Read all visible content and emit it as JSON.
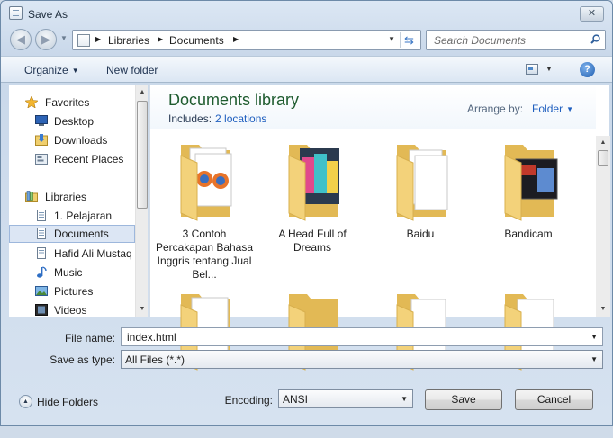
{
  "window": {
    "title": "Save As"
  },
  "address": {
    "segments": [
      "Libraries",
      "Documents"
    ]
  },
  "search": {
    "placeholder": "Search Documents"
  },
  "toolbar": {
    "organize": "Organize",
    "new_folder": "New folder"
  },
  "nav": {
    "items": [
      {
        "label": "Favorites",
        "icon": "star-icon"
      },
      {
        "label": "Desktop",
        "icon": "desktop-icon"
      },
      {
        "label": "Downloads",
        "icon": "downloads-icon"
      },
      {
        "label": "Recent Places",
        "icon": "recent-places-icon"
      },
      {
        "label": "Libraries",
        "icon": "libraries-icon"
      },
      {
        "label": "1. Pelajaran",
        "icon": "document-library-icon"
      },
      {
        "label": "Documents",
        "icon": "document-library-icon",
        "selected": true
      },
      {
        "label": "Hafid Ali Mustaq",
        "icon": "document-library-icon"
      },
      {
        "label": "Music",
        "icon": "music-icon"
      },
      {
        "label": "Pictures",
        "icon": "pictures-icon"
      },
      {
        "label": "Videos",
        "icon": "videos-icon"
      }
    ]
  },
  "library": {
    "title": "Documents library",
    "includes_label": "Includes:",
    "includes_link": "2 locations",
    "arrange_label": "Arrange by:",
    "arrange_value": "Folder"
  },
  "folders": [
    {
      "label": "3 Contoh Percakapan Bahasa Inggris tentang Jual Bel..."
    },
    {
      "label": "A Head Full of Dreams"
    },
    {
      "label": "Baidu"
    },
    {
      "label": "Bandicam"
    },
    {
      "label": ""
    },
    {
      "label": ""
    },
    {
      "label": ""
    },
    {
      "label": ""
    }
  ],
  "form": {
    "filename_label": "File name:",
    "filename_value": "index.html",
    "savetype_label": "Save as type:",
    "savetype_value": "All Files  (*.*)",
    "encoding_label": "Encoding:",
    "encoding_value": "ANSI"
  },
  "footer": {
    "hide_folders": "Hide Folders",
    "save": "Save",
    "cancel": "Cancel"
  },
  "colors": {
    "library_title": "#1e5b2e",
    "link": "#1f5fbf",
    "folder": "#f3d27a"
  }
}
